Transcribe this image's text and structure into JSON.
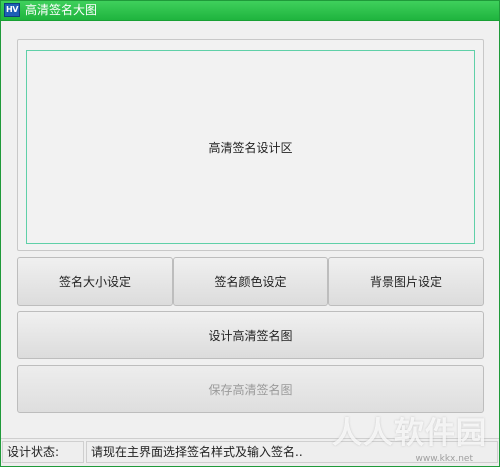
{
  "window": {
    "title": "高清签名大图",
    "app_icon_text": "HV"
  },
  "design_panel": {
    "label": "高清签名设计区"
  },
  "buttons": {
    "size": "签名大小设定",
    "color": "签名颜色设定",
    "background": "背景图片设定",
    "design": "设计高清签名图",
    "save": "保存高清签名图"
  },
  "status": {
    "label": "设计状态:",
    "message": "请现在主界面选择签名样式及输入签名.."
  },
  "watermark": {
    "text": "人人软件园",
    "url": "www.kkx.net"
  },
  "colors": {
    "titlebar": "#1fb43e",
    "design_border": "#5fd0a8",
    "disabled_text": "#9a9a9a"
  }
}
